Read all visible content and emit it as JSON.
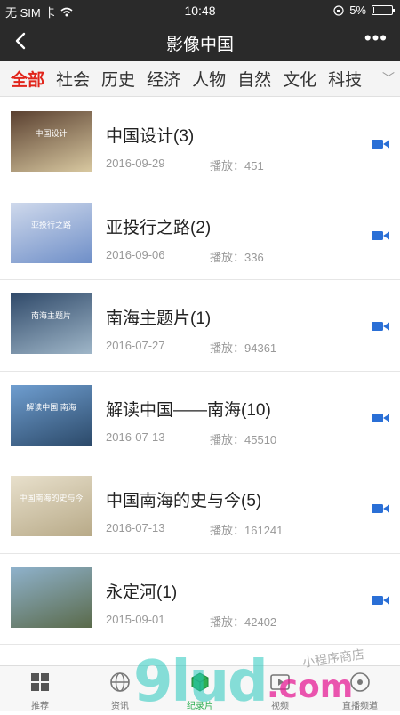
{
  "status": {
    "carrier": "无 SIM 卡",
    "time": "10:48",
    "battery": "5%",
    "battery_level": 0.05
  },
  "nav": {
    "title": "影像中国"
  },
  "tabs": [
    {
      "label": "全部",
      "active": true
    },
    {
      "label": "社会"
    },
    {
      "label": "历史"
    },
    {
      "label": "经济"
    },
    {
      "label": "人物"
    },
    {
      "label": "自然"
    },
    {
      "label": "文化"
    },
    {
      "label": "科技"
    }
  ],
  "items": [
    {
      "title": "中国设计(3)",
      "date": "2016-09-29",
      "plays": "播放：451",
      "thumb_caption": "中国设计",
      "thumb_colors": [
        "#5a4030",
        "#d8c8a0"
      ]
    },
    {
      "title": "亚投行之路(2)",
      "date": "2016-09-06",
      "plays": "播放：336",
      "thumb_caption": "亚投行之路",
      "thumb_colors": [
        "#cfd9ec",
        "#6f8fc8"
      ]
    },
    {
      "title": "南海主题片(1)",
      "date": "2016-07-27",
      "plays": "播放：94361",
      "thumb_caption": "南海主题片",
      "thumb_colors": [
        "#304a6a",
        "#9fb6c8"
      ]
    },
    {
      "title": "解读中国——南海(10)",
      "date": "2016-07-13",
      "plays": "播放：45510",
      "thumb_caption": "解读中国 南海",
      "thumb_colors": [
        "#6f9ed0",
        "#2c4a6a"
      ]
    },
    {
      "title": "中国南海的史与今(5)",
      "date": "2016-07-13",
      "plays": "播放：161241",
      "thumb_caption": "中国南海的史与今",
      "thumb_colors": [
        "#e8e0cc",
        "#b8aa88"
      ]
    },
    {
      "title": "永定河(1)",
      "date": "2015-09-01",
      "plays": "播放：42402",
      "thumb_caption": "",
      "thumb_colors": [
        "#8fb2cc",
        "#5a6a4a"
      ]
    }
  ],
  "tabbar": [
    {
      "label": "推荐",
      "icon": "grid-icon"
    },
    {
      "label": "资讯",
      "icon": "globe-icon"
    },
    {
      "label": "纪录片",
      "icon": "box-icon",
      "active": true
    },
    {
      "label": "视频",
      "icon": "play-icon"
    },
    {
      "label": "直播频道",
      "icon": "live-icon"
    }
  ],
  "watermark": {
    "main": "9lud",
    "suffix": ".com",
    "tag": "小程序商店"
  },
  "colors": {
    "accent": "#e1251b",
    "nav_bg": "#2a2a2a",
    "video_icon": "#2a6fd6",
    "tab_active": "#2eaf52"
  }
}
